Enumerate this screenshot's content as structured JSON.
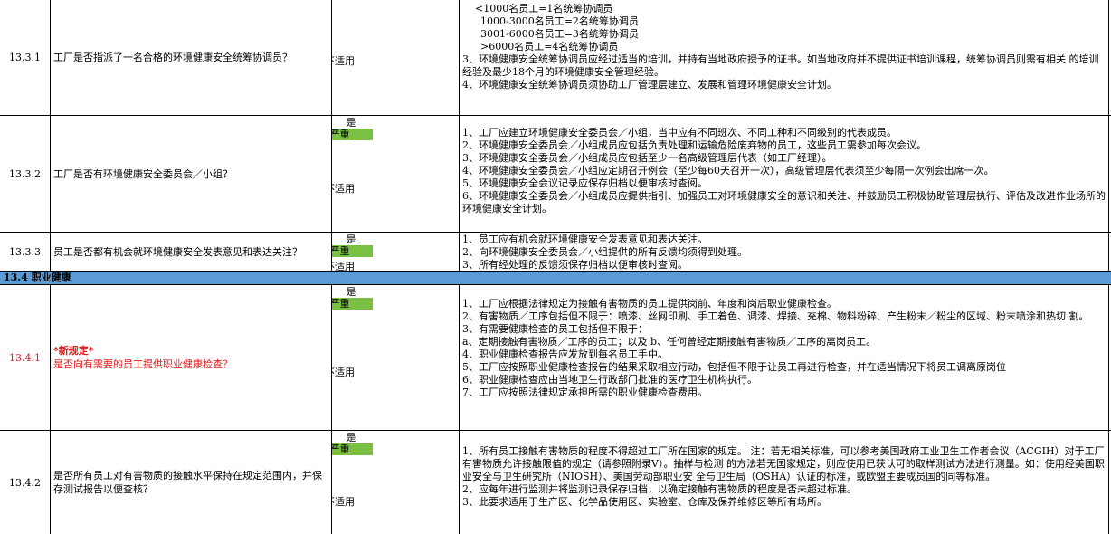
{
  "section": {
    "label": "13.4 职业健康"
  },
  "rows": [
    {
      "id": "13.3.1",
      "question": "工厂是否指派了一名合格的环境健康安全统筹协调员？",
      "status": "不适用",
      "details": [
        "<1000名员工=1名统筹协调员",
        "1000-3000名员工=2名统筹协调员",
        "3001-6000名员工=3名统筹协调员",
        ">6000名员工=4名统筹协调员",
        "3、环境健康安全统筹协调员应经过适当的培训，并持有当地政府授予的证书。如当地政府并不提供证书培训课程，统筹协调员则需有相关 的培训经验及最少18个月的环境健康安全管理经验。",
        "4、环境健康安全统筹协调员须协助工厂管理层建立、发展和管理环境健康安全计划。"
      ]
    },
    {
      "id": "13.3.2",
      "question": "工厂是否有环境健康安全委员会／小组？",
      "yes": "是",
      "severity": "严重",
      "status": "不适用",
      "details": [
        "1、工厂应建立环境健康安全委员会／小组，当中应有不同班次、不同工种和不同级别的代表成员。",
        "2、环境健康安全委员会／小组成员应包括负责处理和运输危险废弃物的员工，这些员工需参加每次会议。",
        "3、环境健康安全委员会／小组成员应包括至少一名高级管理层代表（如工厂经理）。",
        "4、环境健康安全委员会／小组应定期召开例会（至少每60天召开一次），高级管理层代表须至少每隔一次例会出席一次。",
        "5、环境健康安全会议记录应保存归档以便审核时查阅。",
        "6、环境健康安全委员会／小组成员应提供指引、加强员工对环境健康安全的意识和关注、并鼓励员工积极协助管理层执行、评估及改进作业场所的环境健康安全计划。"
      ]
    },
    {
      "id": "13.3.3",
      "question": "员工是否都有机会就环境健康安全发表意见和表达关注？",
      "yes": "是",
      "severity": "严重",
      "status": "不适用",
      "details": [
        "1、员工应有机会就环境健康安全发表意见和表达关注。",
        "2、向环境健康安全委员会／小组提供的所有反馈均须得到处理。",
        "3、所有经处理的反馈须保存归档以便审核时查阅。"
      ]
    },
    {
      "id": "13.4.1",
      "new_label": "*新规定*",
      "question": "是否向有需要的员工提供职业健康检查？",
      "yes": "是",
      "severity": "严重",
      "status": "不适用",
      "details": [
        "1、工厂应根据法律规定为接触有害物质的员工提供岗前、年度和岗后职业健康检查。",
        "2、有害物质／工序包括但不限于：喷漆、丝网印刷、手工着色、调漆、焊接、充棉、物料粉碎、产生粉末／粉尘的区域、粉末喷涂和热切 割。",
        "3、有需要健康检查的员工包括但不限于：",
        "a、定期接触有害物质／工序的员工；以及 b、任何曾经定期接触有害物质／工序的离岗员工。",
        "4、职业健康检查报告应发放到每名员工手中。",
        "5、工厂应按照职业健康检查报告的结果采取相应行动，包括但不限于让员工再进行检查，并在适当情况下将员工调离原岗位",
        "6、职业健康检查应由当地卫生行政部门批准的医疗卫生机构执行。",
        "7、工厂应按照法律规定承担所需的职业健康检查费用。"
      ]
    },
    {
      "id": "13.4.2",
      "question": "是否所有员工对有害物质的接触水平保持在规定范围内，并保存测试报告以便查核？",
      "yes": "是",
      "severity": "严重",
      "status": "不适用",
      "details": [
        "1、所有员工接触有害物质的程度不得超过工厂所在国家的规定。 注：若无相关标准，可以参考美国政府工业卫生工作者会议（ACGIH）对于工厂有害物质允许接触限值的规定（请参照附录V）。抽样与检测 的方法若无国家规定，则应使用已获认可的取样测试方法进行测量。如：使用经美国职业安全与卫生研究所（NIOSH）、美国劳动部职业安 全与卫生局（OSHA）认证的标准，或欧盟主要成员国的同等标准。",
        "2、应每年进行监测并将监测记录保存归档，以确定接触有害物质的程度是否未超过标准。",
        "3、此要求适用于生产区、化学品使用区、实验室、仓库及保养维修区等所有场所。"
      ]
    }
  ]
}
